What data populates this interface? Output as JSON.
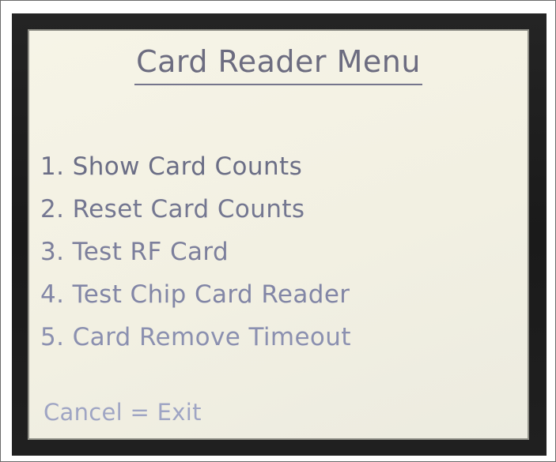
{
  "screen": {
    "title": "Card Reader Menu",
    "menu_items": [
      {
        "label": "1. Show Card Counts",
        "color": "#6b6e86"
      },
      {
        "label": "2. Reset Card Counts",
        "color": "#747791"
      },
      {
        "label": "3. Test RF Card",
        "color": "#7c7f9c"
      },
      {
        "label": "4. Test Chip Card Reader",
        "color": "#8286a6"
      },
      {
        "label": "5. Card Remove Timeout",
        "color": "#8b90b0"
      }
    ],
    "footer": "Cancel = Exit"
  }
}
